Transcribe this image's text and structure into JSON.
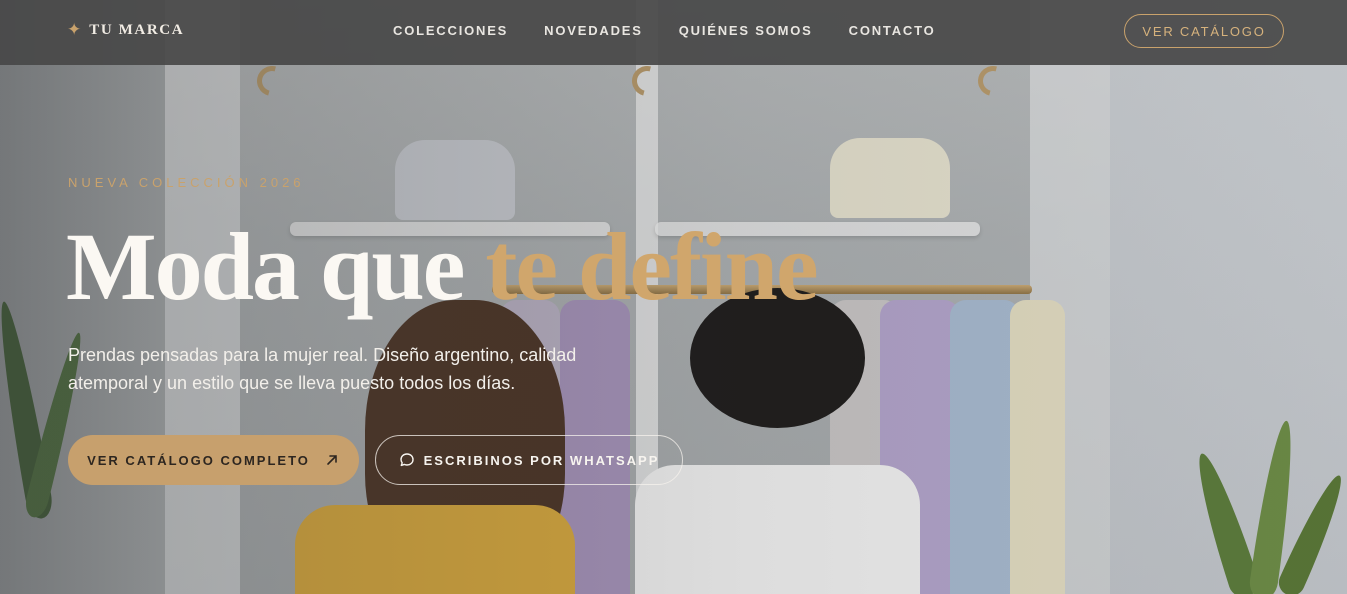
{
  "brand": {
    "icon": "sparkle-star-icon",
    "name": "TU MARCA"
  },
  "nav": {
    "links": [
      "COLECCIONES",
      "NOVEDADES",
      "QUIÉNES SOMOS",
      "CONTACTO"
    ],
    "cta_label": "VER CATÁLOGO"
  },
  "hero": {
    "eyebrow": "NUEVA COLECCIÓN 2026",
    "headline_plain": "Moda que ",
    "headline_accent": "te define",
    "subtitle": "Prendas pensadas para la mujer real. Diseño argentino, calidad atemporal y un estilo que se lleva puesto todos los días.",
    "primary_cta": {
      "label": "VER CATÁLOGO COMPLETO",
      "icon": "arrow-up-right-icon"
    },
    "secondary_cta": {
      "label": "ESCRIBINOS POR WHATSAPP",
      "icon": "chat-bubble-icon"
    }
  },
  "colors": {
    "accent_gold": "#c9a26c",
    "navbar_bg": "#484848",
    "headline_text": "#fbf8f3"
  }
}
